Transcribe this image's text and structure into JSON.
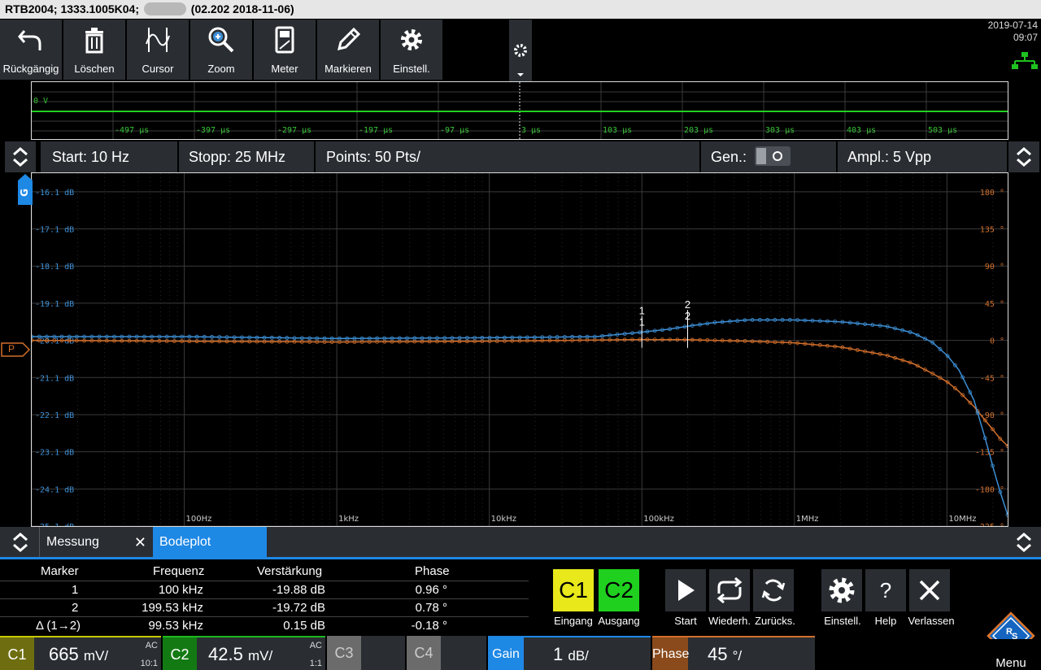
{
  "title_bar": {
    "text_before": "RTB2004; 1333.1005K04;",
    "text_after": "(02.202 2018-11-06)"
  },
  "toolbar": [
    {
      "label": "Rückgängig",
      "icon": "undo-icon"
    },
    {
      "label": "Löschen",
      "icon": "trash-icon"
    },
    {
      "label": "Cursor",
      "icon": "cursor-wave-icon"
    },
    {
      "label": "Zoom",
      "icon": "zoom-icon"
    },
    {
      "label": "Meter",
      "icon": "meter-icon"
    },
    {
      "label": "Markieren",
      "icon": "pencil-icon"
    },
    {
      "label": "Einstell.",
      "icon": "gear-icon"
    }
  ],
  "datetime": {
    "date": "2019-07-14",
    "time": "09:07"
  },
  "overview": {
    "level_label": "0 V",
    "time_labels": [
      "-497 µs",
      "-397 µs",
      "-297 µs",
      "-197 µs",
      "-97 µs",
      "3 µs",
      "103 µs",
      "203 µs",
      "303 µs",
      "403 µs",
      "503 µs"
    ]
  },
  "settings": {
    "start": "Start: 10 Hz",
    "stop": "Stopp: 25 MHz",
    "points": "Points: 50 Pts/",
    "gen": "Gen.:",
    "ampl": "Ampl.: 5 Vpp"
  },
  "chart_data": {
    "type": "line",
    "gain_axis_labels": [
      "-16.1 dB",
      "-17.1 dB",
      "-18.1 dB",
      "-19.1 dB",
      "-20.1 dB",
      "-21.1 dB",
      "-22.1 dB",
      "-23.1 dB",
      "-24.1 dB",
      "-25.1 dB"
    ],
    "phase_axis_labels": [
      "180 °",
      "135 °",
      "90 °",
      "45 °",
      "0 °",
      "-45 °",
      "-90 °",
      "-135 °",
      "-180 °",
      "-225 °"
    ],
    "x_tick_labels": [
      "100Hz",
      "1kHz",
      "10kHz",
      "100kHz",
      "1MHz",
      "10MHz"
    ],
    "x_range_hz": [
      10,
      25000000
    ],
    "gain_range_db": [
      -25.1,
      -15.6
    ],
    "phase_range_deg": [
      -225,
      202.5
    ],
    "x_scale": "log",
    "gain_marker": "G",
    "phase_marker": "P",
    "series": [
      {
        "name": "Gain",
        "color": "#3d8fd6",
        "x_hz": [
          10,
          100,
          1000,
          10000,
          50000,
          100000,
          150000,
          200000,
          300000,
          500000,
          1000000,
          2000000,
          4000000,
          6000000,
          8000000,
          10000000,
          12000000,
          15000000,
          18000000,
          20000000,
          22000000,
          25000000
        ],
        "y_db": [
          -20.0,
          -20.0,
          -20.05,
          -20.03,
          -20.0,
          -19.88,
          -19.8,
          -19.72,
          -19.62,
          -19.55,
          -19.55,
          -19.6,
          -19.72,
          -19.9,
          -20.15,
          -20.5,
          -20.9,
          -21.7,
          -22.8,
          -23.5,
          -24.1,
          -24.8
        ]
      },
      {
        "name": "Phase",
        "color": "#d26f2b",
        "x_hz": [
          10,
          100,
          1000,
          10000,
          100000,
          200000,
          500000,
          1000000,
          2000000,
          4000000,
          6000000,
          8000000,
          10000000,
          12000000,
          15000000,
          18000000,
          20000000,
          22000000,
          25000000
        ],
        "y_deg": [
          0,
          -1,
          -2,
          -1,
          0.96,
          0.78,
          -1,
          -3,
          -8,
          -18,
          -28,
          -40,
          -50,
          -62,
          -80,
          -98,
          -108,
          -118,
          -128
        ]
      }
    ],
    "markers": [
      {
        "label": "1",
        "x_hz": 100000
      },
      {
        "label": "2",
        "x_hz": 199530
      }
    ]
  },
  "tabs": [
    {
      "label": "Messung",
      "close": "✕"
    },
    {
      "label": "Bodeplot"
    }
  ],
  "results": {
    "headers": [
      "Marker",
      "Frequenz",
      "Verstärkung",
      "Phase"
    ],
    "rows": [
      [
        "1",
        "100 kHz",
        "-19.88 dB",
        "0.96 °"
      ],
      [
        "2",
        "199.53 kHz",
        "-19.72 dB",
        "0.78 °"
      ],
      [
        "Δ (1→2)",
        "99.53 kHz",
        "0.15 dB",
        "-0.18 °"
      ]
    ]
  },
  "actions": {
    "c1": {
      "text": "C1",
      "label": "Eingang"
    },
    "c2": {
      "text": "C2",
      "label": "Ausgang"
    },
    "start": "Start",
    "repeat": "Wiederh.",
    "reset": "Zurücks.",
    "settings": "Einstell.",
    "help": "Help",
    "help_glyph": "?",
    "exit": "Verlassen"
  },
  "channels": {
    "c1": {
      "tag": "C1",
      "value": "665",
      "unit": "mV/",
      "coupling": "AC",
      "probe": "10:1",
      "color": "#c8c800"
    },
    "c2": {
      "tag": "C2",
      "value": "42.5",
      "unit": "mV/",
      "coupling": "AC",
      "probe": "1:1",
      "color": "#1fb81f"
    },
    "c3": {
      "tag": "C3"
    },
    "c4": {
      "tag": "C4"
    },
    "gain": {
      "tag": "Gain",
      "value": "1",
      "unit": "dB/"
    },
    "phase": {
      "tag": "Phase",
      "value": "45",
      "unit": "°/"
    },
    "menu": "Menu"
  }
}
